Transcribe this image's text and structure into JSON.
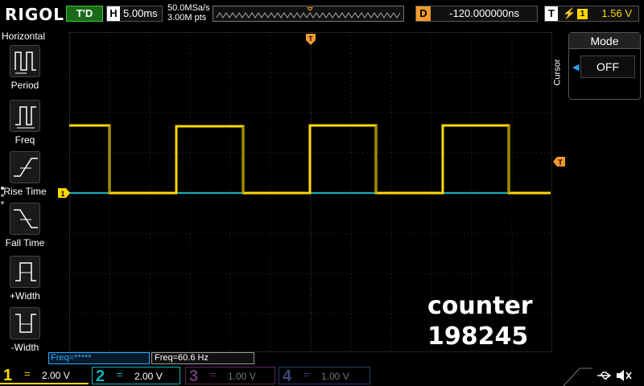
{
  "brand": "RIGOL",
  "status": {
    "trigger_state": "T'D",
    "horizontal_key": "H",
    "timebase": "5.00ms",
    "sample_rate": "50.0MSa/s",
    "memory_depth": "3.00M pts",
    "delay_key": "D",
    "delay_value": "-120.000000ns",
    "trigger_key": "T",
    "trigger_edge": "⚡",
    "trigger_channel": "1",
    "trigger_level": "1.56 V"
  },
  "sidebar": {
    "title": "Horizontal",
    "items": [
      {
        "label": "Period",
        "icon": "period-icon"
      },
      {
        "label": "Freq",
        "icon": "freq-icon"
      },
      {
        "label": "Rise Time",
        "icon": "rise-time-icon"
      },
      {
        "label": "Fall Time",
        "icon": "fall-time-icon"
      },
      {
        "label": "+Width",
        "icon": "positive-width-icon"
      },
      {
        "label": "-Width",
        "icon": "negative-width-icon"
      }
    ]
  },
  "cursor_panel": {
    "title": "Cursor",
    "mode_label": "Mode",
    "mode_value": "OFF"
  },
  "overlay": {
    "line1": "counter",
    "line2": "198245"
  },
  "measurements": {
    "freq1": "Freq=*****",
    "freq2": "Freq=60.6 Hz"
  },
  "channels": [
    {
      "num": "1",
      "coupling": "=",
      "scale": "2.00 V",
      "color": "#ffd800"
    },
    {
      "num": "2",
      "coupling": "=",
      "scale": "2.00 V",
      "color": "#10b2b8"
    },
    {
      "num": "3",
      "coupling": "=",
      "scale": "1.00 V",
      "color": "#8a4a8a"
    },
    {
      "num": "4",
      "coupling": "=",
      "scale": "1.00 V",
      "color": "#4a5a9a"
    }
  ],
  "markers": {
    "ch1_marker": "1",
    "trigger_marker": "T"
  },
  "colors": {
    "ch1": "#ffd800",
    "ch2": "#10b2b8",
    "trigger": "#f29a2e"
  }
}
